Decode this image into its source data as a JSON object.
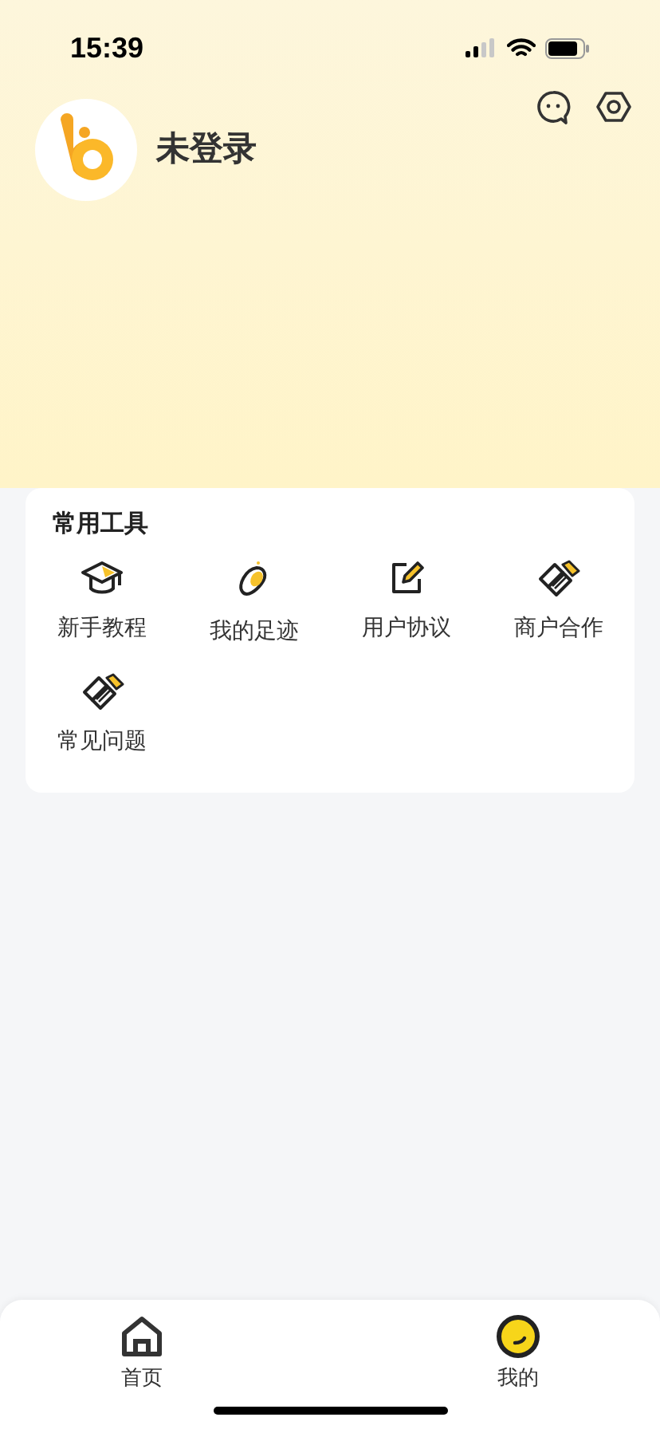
{
  "status_bar": {
    "time": "15:39"
  },
  "profile": {
    "name": "未登录"
  },
  "tools": {
    "title": "常用工具",
    "items": [
      {
        "label": "新手教程"
      },
      {
        "label": "我的足迹"
      },
      {
        "label": "用户协议"
      },
      {
        "label": "商户合作"
      },
      {
        "label": "常见问题"
      }
    ]
  },
  "tab_bar": [
    {
      "label": "首页",
      "selected": false
    },
    {
      "label": "我的",
      "selected": true
    }
  ]
}
